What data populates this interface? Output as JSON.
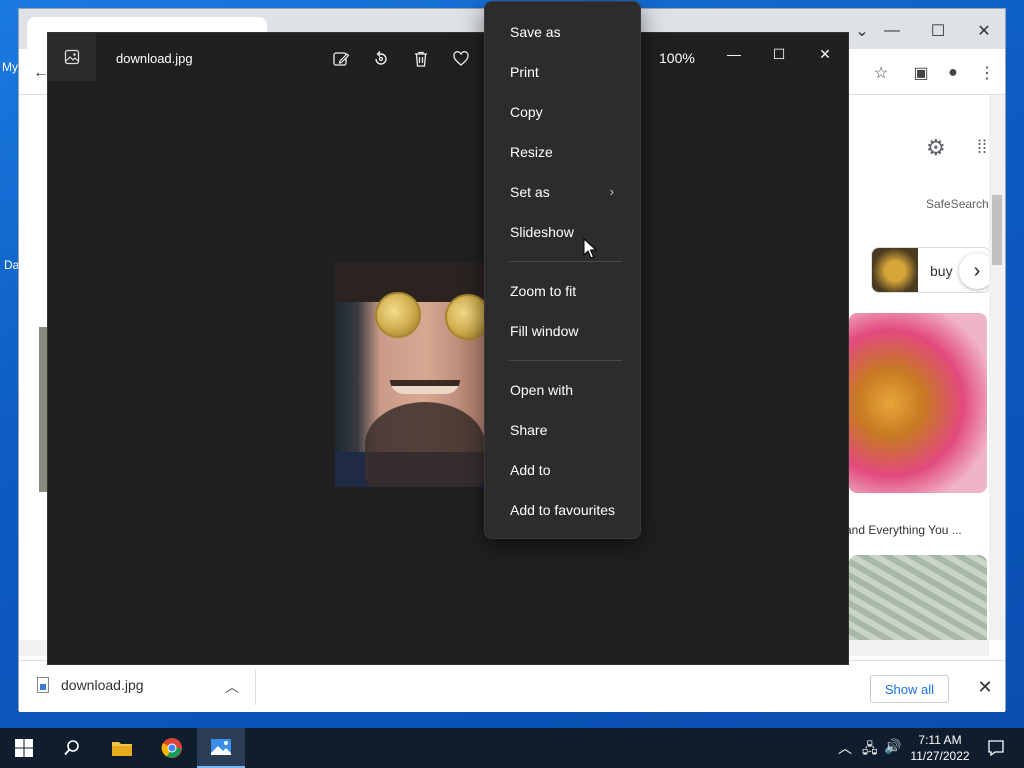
{
  "desktop": {
    "icon_label_1": "My",
    "icon_label_2": "Da"
  },
  "chrome": {
    "page": {
      "safesearch_label": "SafeSearch",
      "chip_label": "buy",
      "image_caption": "and Everything You ..."
    },
    "downloads": {
      "file_name": "download.jpg",
      "show_all_label": "Show all"
    }
  },
  "photos": {
    "file_name": "download.jpg",
    "zoom": "100%",
    "toolbar_icons": [
      "edit-icon",
      "rotate-icon",
      "delete-icon",
      "favourite-icon"
    ]
  },
  "context_menu": {
    "items": [
      {
        "label": "Save as"
      },
      {
        "label": "Print"
      },
      {
        "label": "Copy"
      },
      {
        "label": "Resize"
      },
      {
        "label": "Set as",
        "has_submenu": true
      },
      {
        "label": "Slideshow"
      },
      {
        "label": "Zoom to fit"
      },
      {
        "label": "Fill window"
      },
      {
        "label": "Open with"
      },
      {
        "label": "Share"
      },
      {
        "label": "Add to"
      },
      {
        "label": "Add to favourites"
      }
    ]
  },
  "taskbar": {
    "time": "7:11 AM",
    "date": "11/27/2022",
    "apps": [
      "start-icon",
      "search-icon",
      "file-explorer-icon",
      "chrome-icon",
      "photos-icon"
    ]
  },
  "colors": {
    "desktop_blue": "#0d5cc4",
    "photos_bg": "#202020",
    "menu_bg": "#2c2c2c",
    "taskbar_bg": "#101d2e",
    "link_blue": "#1a73e8"
  }
}
